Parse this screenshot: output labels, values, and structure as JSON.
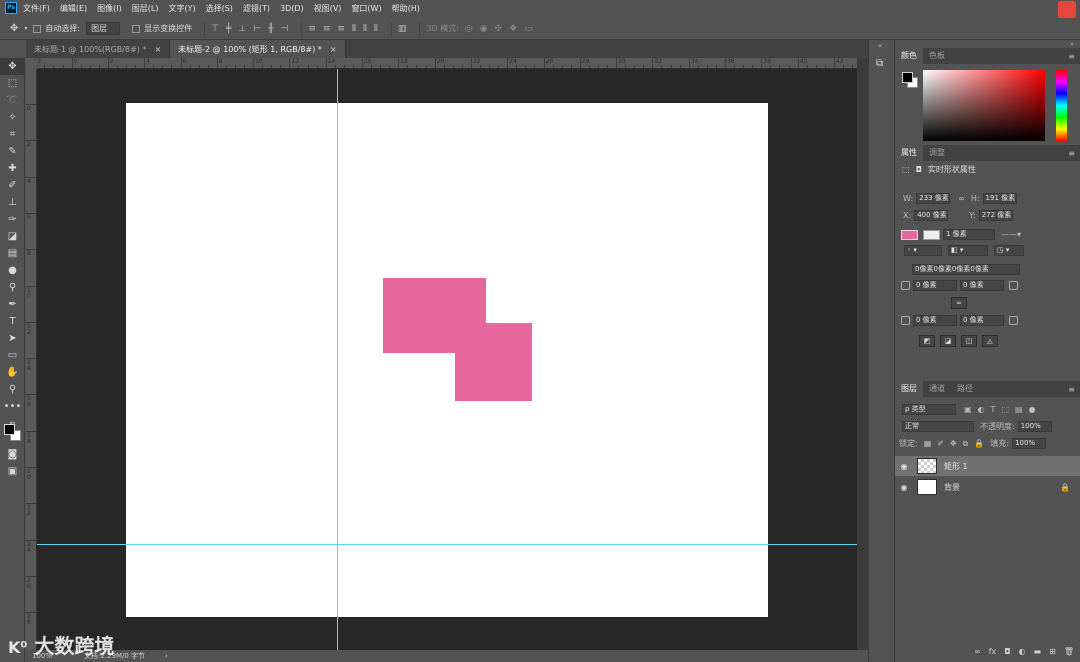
{
  "menubar": {
    "logo": "Ps",
    "items": [
      "文件(F)",
      "编辑(E)",
      "图像(I)",
      "图层(L)",
      "文字(Y)",
      "选择(S)",
      "滤镜(T)",
      "3D(D)",
      "视图(V)",
      "窗口(W)",
      "帮助(H)"
    ]
  },
  "options": {
    "auto_select_label": "自动选择:",
    "auto_select_value": "图层",
    "show_transform_label": "显示变换控件",
    "mode_3d_label": "3D 模式:"
  },
  "tabs": [
    {
      "label": "未标题-1 @ 100%(RGB/8#) *",
      "close": "×"
    },
    {
      "label": "未标题-2 @ 100% (矩形 1, RGB/8#) *",
      "close": "×"
    }
  ],
  "rulers": {
    "top": [
      "4",
      "2",
      "0",
      "2",
      "4",
      "6",
      "8",
      "10",
      "12",
      "14",
      "16",
      "18",
      "20",
      "22",
      "24",
      "26",
      "28",
      "30",
      "32",
      "34",
      "36",
      "38",
      "40",
      "42"
    ],
    "left": [
      "0",
      "2",
      "4",
      "6",
      "8",
      "1 0",
      "1 2",
      "1 4",
      "1 6",
      "1 8",
      "2 0",
      "2 2",
      "2 4",
      "2 6",
      "2 8",
      "3 0"
    ]
  },
  "status": {
    "zoom": "100%",
    "doc": "文档:2.29M/0 字节"
  },
  "watermark": "大数跨境",
  "color_panel": {
    "tabs": [
      "颜色",
      "色板"
    ]
  },
  "properties": {
    "tabs": [
      "属性",
      "调整"
    ],
    "header": "实时形状属性",
    "w_label": "W:",
    "w_value": "233 像素",
    "h_label": "H:",
    "h_value": "191 像素",
    "x_label": "X:",
    "x_value": "400 像素",
    "y_label": "Y:",
    "y_value": "272 像素",
    "stroke_width": "1 像素",
    "corner_all": "0像素0像素0像素0像素",
    "corner_tl": "0 像素",
    "corner_tr": "0 像素",
    "corner_bl": "0 像素",
    "corner_br": "0 像素"
  },
  "layers": {
    "tabs": [
      "图层",
      "通道",
      "路径"
    ],
    "filter_kind": "ρ 类型",
    "blend_mode": "正常",
    "opacity_label": "不透明度:",
    "opacity_value": "100%",
    "lock_label": "锁定:",
    "fill_label": "填充:",
    "fill_value": "100%",
    "items": [
      {
        "name": "矩形 1"
      },
      {
        "name": "背景"
      }
    ],
    "footer_fx": "fx"
  },
  "colors": {
    "shape_fill": "#e8679f",
    "guide": "#5ad8f0"
  }
}
